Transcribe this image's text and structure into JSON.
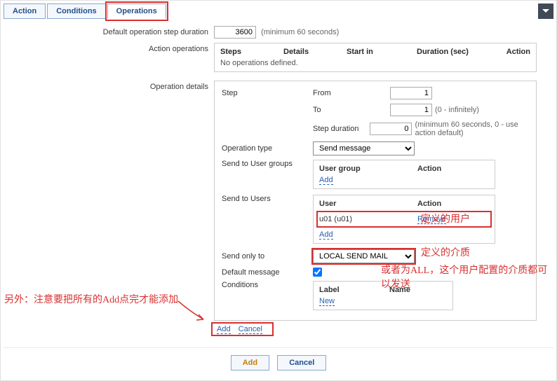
{
  "tabs": {
    "items": [
      "Action",
      "Conditions",
      "Operations"
    ]
  },
  "duration": {
    "label": "Default operation step duration",
    "value": "3600",
    "hint": "(minimum 60 seconds)"
  },
  "actionOps": {
    "label": "Action operations",
    "headers": [
      "Steps",
      "Details",
      "Start in",
      "Duration (sec)",
      "Action"
    ],
    "noOps": "No operations defined."
  },
  "opDetails": {
    "label": "Operation details",
    "step": {
      "label": "Step",
      "fromLabel": "From",
      "fromValue": "1",
      "toLabel": "To",
      "toValue": "1",
      "toHint": "(0 - infinitely)",
      "durLabel": "Step duration",
      "durValue": "0",
      "durHint": "(minimum 60 seconds, 0 - use action default)"
    },
    "opType": {
      "label": "Operation type",
      "value": "Send message"
    },
    "userGroups": {
      "label": "Send to User groups",
      "h1": "User group",
      "h2": "Action",
      "add": "Add"
    },
    "users": {
      "label": "Send to Users",
      "h1": "User",
      "h2": "Action",
      "row1_user": "u01 (u01)",
      "row1_action": "Remove",
      "add": "Add"
    },
    "sendOnly": {
      "label": "Send only to",
      "value": "LOCAL SEND MAIL"
    },
    "defMsg": {
      "label": "Default message"
    },
    "conditions": {
      "label": "Conditions",
      "h1": "Label",
      "h2": "Name",
      "new": "New"
    },
    "cmds": {
      "add": "Add",
      "cancel": "Cancel"
    }
  },
  "footer": {
    "add": "Add",
    "cancel": "Cancel"
  },
  "annotations": {
    "a1": "定义的用户",
    "a2": "定义的介质",
    "a3": "或者为ALL，这个用户配置的介质都可以发送",
    "a4": "另外：注意要把所有的Add点完才能添加"
  }
}
